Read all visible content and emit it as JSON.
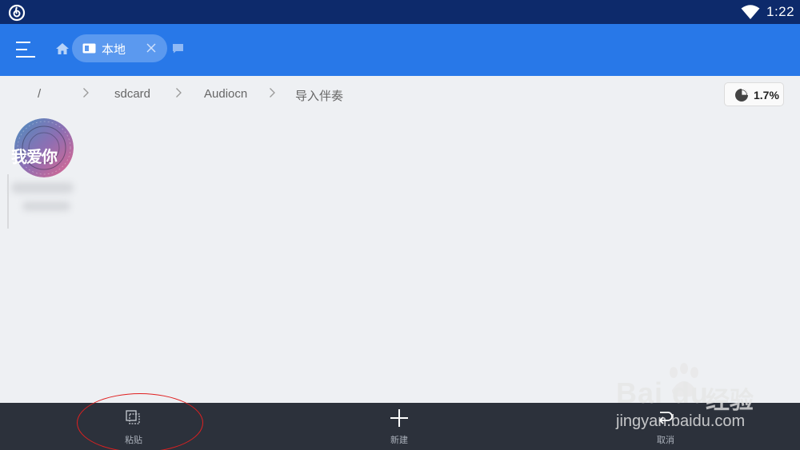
{
  "status_bar": {
    "time": "1:22",
    "app_icon": "netease-music-icon",
    "wifi_icon": "wifi-icon"
  },
  "app_bar": {
    "menu_icon": "menu-icon",
    "home_icon": "home-icon",
    "active_tab": {
      "label": "本地",
      "icon": "drive-icon",
      "close_icon": "close-icon"
    },
    "more_icon": "window-icon",
    "color": "#2878e8"
  },
  "breadcrumb": {
    "items": [
      "/",
      "sdcard",
      "Audiocn",
      "导入伴奏"
    ],
    "separator_icon": "chevron-right-icon"
  },
  "storage": {
    "value": "1.7%",
    "icon": "pie-chart-icon"
  },
  "files": [
    {
      "thumbnail_text": "我爱你",
      "name": "",
      "type": "image"
    }
  ],
  "bottom_bar": {
    "actions": [
      {
        "label": "粘贴",
        "icon": "paste-icon"
      },
      {
        "label": "新建",
        "icon": "plus-icon"
      },
      {
        "label": "取消",
        "icon": "undo-icon"
      }
    ]
  },
  "watermark": {
    "brand_latin": "Bai du",
    "brand_cn": "经验",
    "url": "jingyan.baidu.com"
  }
}
